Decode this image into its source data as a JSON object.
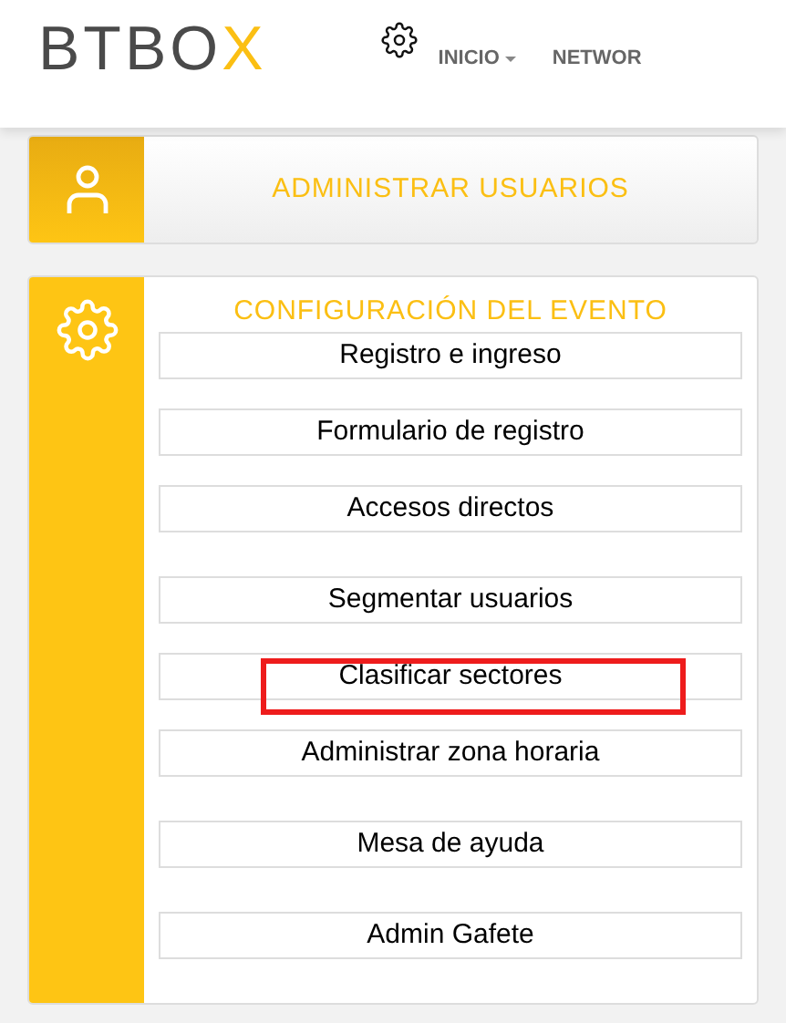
{
  "header": {
    "logo": {
      "text": "BTBO",
      "accent": "X"
    },
    "nav": [
      {
        "label": "INICIO",
        "dropdown": true
      },
      {
        "label": "NETWOR",
        "dropdown": false
      }
    ]
  },
  "cards": [
    {
      "kind": "link",
      "title": "ADMINISTRAR USUARIOS"
    },
    {
      "kind": "menu",
      "title": "CONFIGURACIÓN DEL EVENTO",
      "groups": [
        [
          {
            "label": "Registro e ingreso",
            "highlighted": false
          },
          {
            "label": "Formulario de registro",
            "highlighted": false
          },
          {
            "label": "Accesos directos",
            "highlighted": false
          }
        ],
        [
          {
            "label": "Segmentar usuarios",
            "highlighted": false
          },
          {
            "label": "Clasificar sectores",
            "highlighted": true
          },
          {
            "label": "Administrar zona horaria",
            "highlighted": false
          }
        ],
        [
          {
            "label": "Mesa de ayuda",
            "highlighted": false
          }
        ],
        [
          {
            "label": "Admin Gafete",
            "highlighted": false
          }
        ]
      ]
    }
  ]
}
